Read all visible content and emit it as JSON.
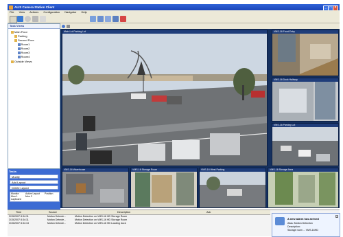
{
  "window": {
    "title": "ALIS Camera Station Client"
  },
  "menu": [
    "File",
    "View",
    "Actions",
    "Configuration",
    "Navigator",
    "Help"
  ],
  "toolbar_icons": [
    "cursor-icon",
    "pan-icon",
    "zoom-icon",
    "camera-icon",
    "record-icon",
    "layout-1-icon",
    "layout-2-icon",
    "layout-3-icon",
    "layout-4-icon",
    "alarm-icon"
  ],
  "sidebar": {
    "header": "Task Views",
    "tree": [
      {
        "label": "Main Floor",
        "level": 0,
        "type": "folder"
      },
      {
        "label": "Parking",
        "level": 1,
        "type": "folder"
      },
      {
        "label": "Second Floor",
        "level": 1,
        "type": "folder"
      },
      {
        "label": "Room1",
        "level": 2,
        "type": "camera"
      },
      {
        "label": "Room2",
        "level": 2,
        "type": "camera"
      },
      {
        "label": "Room3",
        "level": 2,
        "type": "camera"
      },
      {
        "label": "Room4",
        "level": 2,
        "type": "camera"
      },
      {
        "label": "Outside Views",
        "level": 0,
        "type": "folder"
      }
    ]
  },
  "task_panel": {
    "header": "Tasks",
    "buttons": [
      "Modify",
      "Add Layout",
      "Delete Layout"
    ],
    "grid_headers": [
      "Monitor",
      "Active Layout",
      "Position"
    ],
    "grid_values": [
      "Mon 1",
      "Mon 2",
      "Lapboard"
    ]
  },
  "cameras": {
    "main": {
      "label": "Main Lot    Parking Lot"
    },
    "right": [
      {
        "label": "VMS-16  Front Entry"
      },
      {
        "label": "VMS-16  Dock Hallway"
      },
      {
        "label": "VMS-16  Parking Lot"
      }
    ],
    "bottom": [
      {
        "label": "VMS-16  Warehouse"
      },
      {
        "label": "VMS-16  Storage Room"
      },
      {
        "label": "VMS-16  West Parking"
      },
      {
        "label": "VMS-16  Storage Area"
      }
    ]
  },
  "alarm_grid": {
    "headers": [
      "Time",
      "Source",
      "Description",
      "Ack"
    ],
    "rows": [
      {
        "time": "3/15/2007 8:34:11",
        "source": "Motion Detecte...",
        "desc": "Motion Detection on VMS-16 HD  Storage Room"
      },
      {
        "time": "3/15/2007 8:34:11",
        "source": "Motion Detecte...",
        "desc": "Motion Detection on VMS-16 HD  Storage Room"
      },
      {
        "time": "3/15/2007 8:34:13",
        "source": "Motion Detecte...",
        "desc": "Motion Detection on VMS-16 HD  Loading dock"
      }
    ]
  },
  "toast": {
    "title": "A new alarm has arrived",
    "body_1": "Alias: Motion Detection",
    "body_2": "Description:",
    "body_3": "Storage room ... VMS-16HD"
  },
  "colors": {
    "title_blue": "#1b44b8",
    "panel_blue": "#3c6bd3",
    "sky": "#cdd7e2",
    "asphalt": "#6f7275"
  }
}
